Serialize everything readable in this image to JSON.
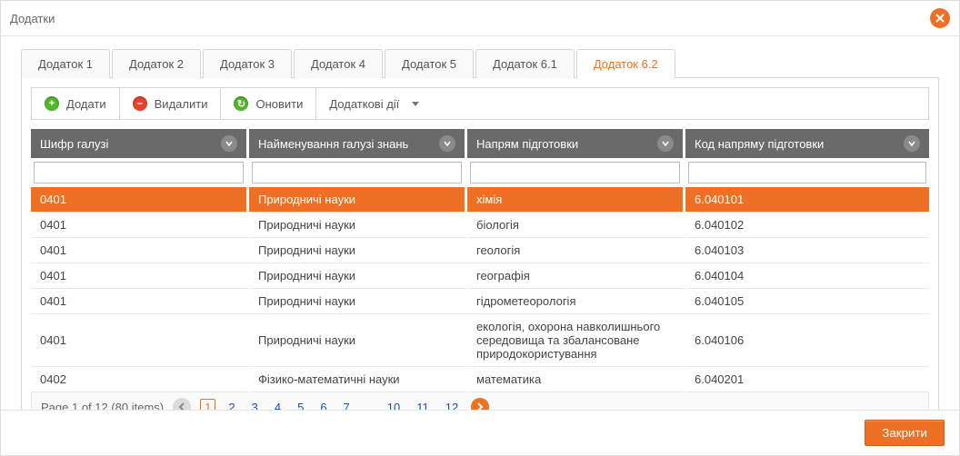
{
  "window": {
    "title": "Додатки"
  },
  "tabs": [
    {
      "label": "Додаток 1"
    },
    {
      "label": "Додаток 2"
    },
    {
      "label": "Додаток 3"
    },
    {
      "label": "Додаток 4"
    },
    {
      "label": "Додаток 5"
    },
    {
      "label": "Додаток 6.1"
    },
    {
      "label": "Додаток 6.2"
    }
  ],
  "active_tab": 6,
  "toolbar": {
    "add": "Додати",
    "delete": "Видалити",
    "refresh": "Оновити",
    "extra": "Додаткові дії"
  },
  "columns": [
    "Шифр галузі",
    "Найменування галузі знань",
    "Напрям підготовки",
    "Код напряму підготовки"
  ],
  "rows": [
    {
      "c0": "0401",
      "c1": "Природничі науки",
      "c2": "хімія",
      "c3": "6.040101"
    },
    {
      "c0": "0401",
      "c1": "Природничі науки",
      "c2": "біологія",
      "c3": "6.040102"
    },
    {
      "c0": "0401",
      "c1": "Природничі науки",
      "c2": "геологія",
      "c3": "6.040103"
    },
    {
      "c0": "0401",
      "c1": "Природничі науки",
      "c2": "географія",
      "c3": "6.040104"
    },
    {
      "c0": "0401",
      "c1": "Природничі науки",
      "c2": "гідрометеорологія",
      "c3": "6.040105"
    },
    {
      "c0": "0401",
      "c1": "Природничі науки",
      "c2": "екологія, охорона навколишнього середовища та збалансоване природокористування",
      "c3": "6.040106"
    },
    {
      "c0": "0402",
      "c1": "Фізико-математичні науки",
      "c2": "математика",
      "c3": "6.040201"
    }
  ],
  "selected_row": 0,
  "pager": {
    "summary": "Page 1 of 12 (80 items)",
    "pages_left": [
      "1",
      "2",
      "3",
      "4",
      "5",
      "6",
      "7"
    ],
    "ellipsis": "…",
    "pages_right": [
      "10",
      "11",
      "12"
    ],
    "current": "1"
  },
  "footer": {
    "close": "Закрити"
  }
}
